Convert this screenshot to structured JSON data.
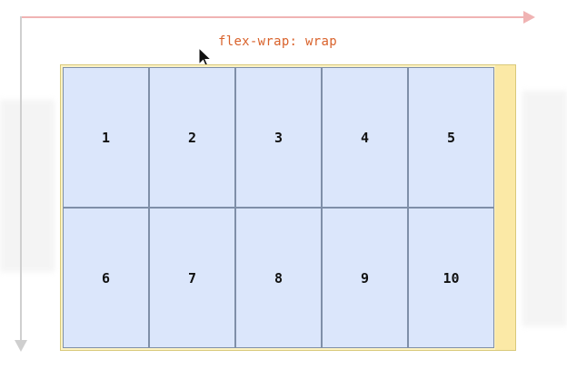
{
  "title_code": "flex-wrap: wrap",
  "items": [
    "1",
    "2",
    "3",
    "4",
    "5",
    "6",
    "7",
    "8",
    "9",
    "10"
  ],
  "colors": {
    "main_axis_arrow": "#f0b3b3",
    "cross_axis_arrow": "#cfcfcf",
    "label": "#d9622b",
    "container_bg": "#fdf3c4",
    "item_bg": "#dbe6fb",
    "item_border": "#7f8fa8"
  },
  "icons": {
    "cursor": "mouse-pointer-icon"
  }
}
